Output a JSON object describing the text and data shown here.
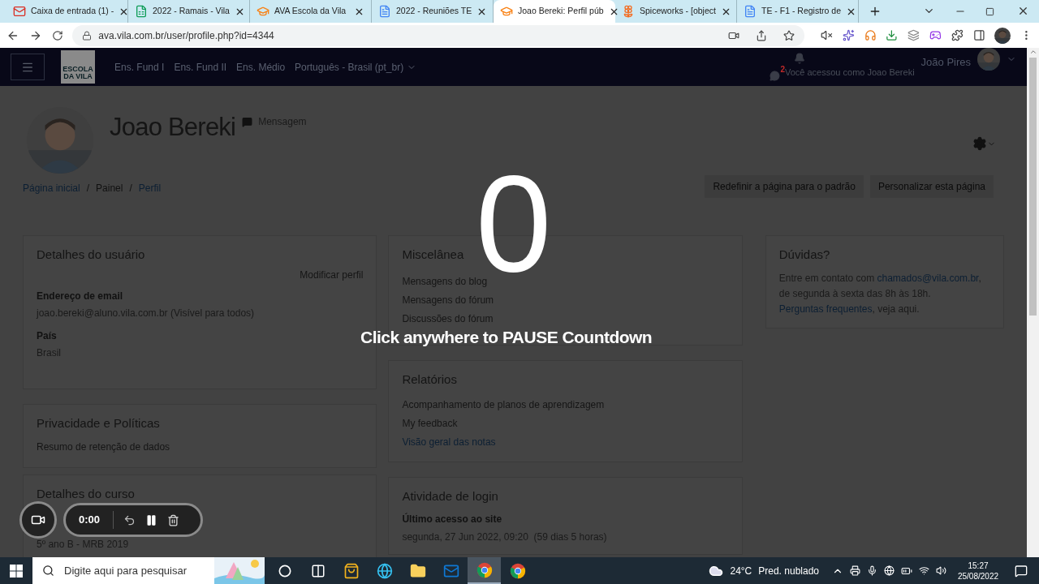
{
  "browser": {
    "tabs": [
      {
        "title": "Caixa de entrada (1) -",
        "kind": "mail",
        "selected": false
      },
      {
        "title": "2022 - Ramais - Vila",
        "kind": "sheet",
        "selected": false
      },
      {
        "title": "AVA Escola da Vila",
        "kind": "school",
        "selected": false
      },
      {
        "title": "2022 - Reuniões TE",
        "kind": "doc",
        "selected": false
      },
      {
        "title": "Joao Bereki: Perfil púb",
        "kind": "school",
        "selected": true
      },
      {
        "title": "Spiceworks - [object",
        "kind": "flower",
        "selected": false
      },
      {
        "title": "TE - F1 - Registro de",
        "kind": "doc",
        "selected": false
      }
    ],
    "url": "ava.vila.com.br/user/profile.php?id=4344"
  },
  "navbar": {
    "logo_top": "ESCOLA",
    "logo_bottom": "DA VILA",
    "links": [
      "Ens. Fund I",
      "Ens. Fund II",
      "Ens. Médio"
    ],
    "language": "Português - Brasil (pt_br)",
    "user": "João Pires",
    "message_count": "2",
    "login_as": "Você acessou como Joao Bereki"
  },
  "profile": {
    "name": "Joao Bereki",
    "message": "Mensagem"
  },
  "breadcrumb": [
    {
      "label": "Página inicial",
      "kind": "link"
    },
    {
      "label": "/",
      "kind": "separator"
    },
    {
      "label": "Painel",
      "kind": "text"
    },
    {
      "label": "/",
      "kind": "separator"
    },
    {
      "label": "Perfil",
      "kind": "link"
    }
  ],
  "page_buttons": [
    "Redefinir a página para o padrão",
    "Personalizar esta página"
  ],
  "user_details": {
    "title": "Detalhes do usuário",
    "edit": "Modificar perfil",
    "fields": [
      {
        "label": "Endereço de email",
        "value": "joao.bereki@aluno.vila.com.br (Visível para todos)"
      },
      {
        "label": "País",
        "value": "Brasil"
      }
    ]
  },
  "privacy": {
    "title": "Privacidade e Políticas",
    "items": [
      "Resumo de retenção de dados"
    ]
  },
  "course_details": {
    "title": "Detalhes do curso",
    "items": [
      "5º ano B - MRB 2019"
    ]
  },
  "misc": {
    "title": "Miscelânea",
    "items": [
      "Mensagens do blog",
      "Mensagens do fórum",
      "Discussões do fórum"
    ]
  },
  "reports": {
    "title": "Relatórios",
    "items": [
      {
        "text": "Acompanhamento de planos de aprendizagem",
        "kind": "text"
      },
      {
        "text": "My feedback",
        "kind": "text"
      },
      {
        "text": "Visão geral das notas",
        "kind": "link"
      }
    ]
  },
  "login_activity": {
    "title": "Atividade de login",
    "label": "Último acesso ao site",
    "value": "segunda, 27 Jun 2022, 09:20  (59 dias 5 horas)"
  },
  "help": {
    "title": "Dúvidas?",
    "paragraphs": [
      [
        {
          "text": "Entre em contato com ",
          "kind": "text"
        },
        {
          "text": "chamados@vila.com.br",
          "kind": "link"
        },
        {
          "text": ", de segunda à sexta das 8h às 18h.",
          "kind": "text"
        }
      ],
      [
        {
          "text": "Perguntas frequentes",
          "kind": "link"
        },
        {
          "text": ", veja aqui.",
          "kind": "text"
        }
      ]
    ]
  },
  "countdown": {
    "number": "0",
    "message": "Click anywhere to PAUSE Countdown"
  },
  "recorder": {
    "time": "0:00"
  },
  "taskbar": {
    "search_placeholder": "Digite aqui para pesquisar",
    "apps": [
      {
        "kind": "cortana",
        "selected": false
      },
      {
        "kind": "taskview",
        "selected": false
      },
      {
        "kind": "store",
        "selected": false
      },
      {
        "kind": "edge",
        "selected": false
      },
      {
        "kind": "folder",
        "selected": false
      },
      {
        "kind": "mail",
        "selected": false
      },
      {
        "kind": "chrome",
        "selected": true
      },
      {
        "kind": "chrome",
        "selected": false
      }
    ],
    "temperature": "24°C",
    "forecast": "Pred. nublado",
    "time": "15:27",
    "date": "25/08/2022"
  }
}
